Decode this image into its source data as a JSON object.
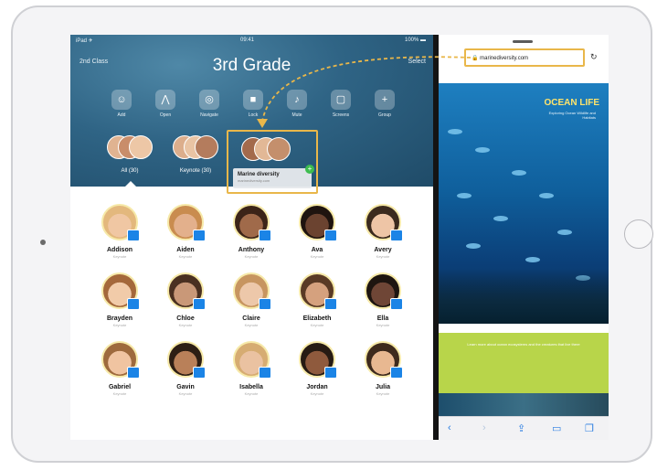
{
  "status": {
    "carrier": "iPad ✈",
    "time": "09:41",
    "battery": "100% ▬"
  },
  "classroom": {
    "nav_left": "2nd Class",
    "title": "3rd Grade",
    "nav_right": "Select",
    "toolbar": [
      {
        "label": "Add",
        "icon": "person-icon",
        "glyph": "☺"
      },
      {
        "label": "Open",
        "icon": "open-icon",
        "glyph": "⋀"
      },
      {
        "label": "Navigate",
        "icon": "compass-icon",
        "glyph": "◎"
      },
      {
        "label": "Lock",
        "icon": "lock-icon",
        "glyph": "■"
      },
      {
        "label": "Mute",
        "icon": "mute-icon",
        "glyph": "♪"
      },
      {
        "label": "Screens",
        "icon": "screens-icon",
        "glyph": "▢"
      },
      {
        "label": "Group",
        "icon": "plus-icon",
        "glyph": "+"
      }
    ],
    "groups": [
      {
        "label": "All (30)"
      },
      {
        "label": "Keynote (30)"
      }
    ],
    "popup": {
      "title": "Marine diversity",
      "subtitle": "marinediversity.com"
    },
    "students": [
      {
        "name": "Addison",
        "sub": "Keynote"
      },
      {
        "name": "Aiden",
        "sub": "Keynote"
      },
      {
        "name": "Anthony",
        "sub": "Keynote"
      },
      {
        "name": "Ava",
        "sub": "Keynote"
      },
      {
        "name": "Avery",
        "sub": "Keynote"
      },
      {
        "name": "Brayden",
        "sub": "Keynote"
      },
      {
        "name": "Chloe",
        "sub": "Keynote"
      },
      {
        "name": "Claire",
        "sub": "Keynote"
      },
      {
        "name": "Elizabeth",
        "sub": "Keynote"
      },
      {
        "name": "Ella",
        "sub": "Keynote"
      },
      {
        "name": "Gabriel",
        "sub": "Keynote"
      },
      {
        "name": "Gavin",
        "sub": "Keynote"
      },
      {
        "name": "Isabella",
        "sub": "Keynote"
      },
      {
        "name": "Jordan",
        "sub": "Keynote"
      },
      {
        "name": "Julia",
        "sub": "Keynote"
      }
    ]
  },
  "safari": {
    "url": "marinediversity.com",
    "reload_icon": "↻",
    "page_title": "OCEAN LIFE",
    "page_subtitle": "Exploring Ocean Wildlife and Habitats",
    "green_text": "Learn more about ocean ecosystems and the creatures that live there",
    "toolbar": [
      {
        "icon": "back-icon",
        "glyph": "‹"
      },
      {
        "icon": "forward-icon",
        "glyph": "›"
      },
      {
        "icon": "share-icon",
        "glyph": "⇪"
      },
      {
        "icon": "bookmarks-icon",
        "glyph": "▭"
      },
      {
        "icon": "tabs-icon",
        "glyph": "❐"
      }
    ]
  },
  "colors": {
    "highlight": "#e9b74a",
    "accent": "#1b84e6",
    "safari_green": "#b8d54a"
  }
}
